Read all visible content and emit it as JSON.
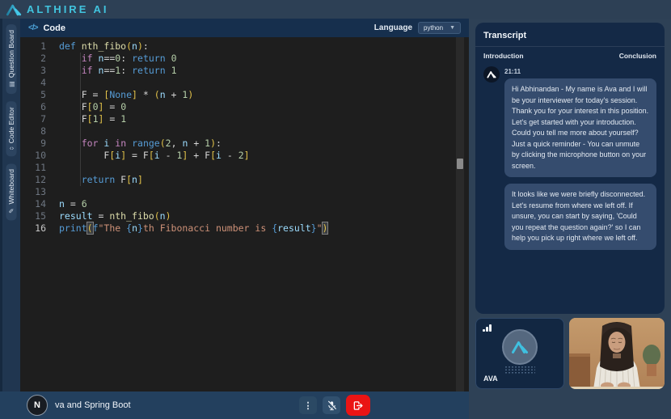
{
  "colors": {
    "accent_cyan": "#41c4de",
    "leave_red": "#ea1414",
    "editor_bg": "#1e1e1e",
    "panel_navy": "#2e4156",
    "card_navy": "#142946",
    "bubble": "#354c6e"
  },
  "header": {
    "brand": "ALTHIRE AI"
  },
  "sidebar": {
    "tabs": [
      {
        "label": "Question Board",
        "icon": "board-icon",
        "glyph": "▤"
      },
      {
        "label": "Code Editor",
        "icon": "code-editor-icon",
        "glyph": "‹›"
      },
      {
        "label": "Whiteboard",
        "icon": "pen-icon",
        "glyph": "✎"
      }
    ]
  },
  "editor": {
    "panel_title": "Code",
    "panel_icon_glyph": "</>",
    "language_label": "Language",
    "language_value": "python",
    "lines": [
      [
        {
          "t": "def ",
          "c": "kw"
        },
        {
          "t": "nth_fibo",
          "c": "fn"
        },
        {
          "t": "(",
          "c": "br"
        },
        {
          "t": "n",
          "c": "var"
        },
        {
          "t": ")",
          "c": "br"
        },
        {
          "t": ":",
          "c": "pl"
        }
      ],
      [
        {
          "t": "    ",
          "c": "pl"
        },
        {
          "t": "if",
          "c": "ctl"
        },
        {
          "t": " ",
          "c": "pl"
        },
        {
          "t": "n",
          "c": "var"
        },
        {
          "t": "==",
          "c": "pl"
        },
        {
          "t": "0",
          "c": "num"
        },
        {
          "t": ": ",
          "c": "pl"
        },
        {
          "t": "return",
          "c": "kw"
        },
        {
          "t": " ",
          "c": "pl"
        },
        {
          "t": "0",
          "c": "num"
        }
      ],
      [
        {
          "t": "    ",
          "c": "pl"
        },
        {
          "t": "if",
          "c": "ctl"
        },
        {
          "t": " ",
          "c": "pl"
        },
        {
          "t": "n",
          "c": "var"
        },
        {
          "t": "==",
          "c": "pl"
        },
        {
          "t": "1",
          "c": "num"
        },
        {
          "t": ": ",
          "c": "pl"
        },
        {
          "t": "return",
          "c": "kw"
        },
        {
          "t": " ",
          "c": "pl"
        },
        {
          "t": "1",
          "c": "num"
        }
      ],
      [],
      [
        {
          "t": "    F = ",
          "c": "pl"
        },
        {
          "t": "[",
          "c": "br"
        },
        {
          "t": "None",
          "c": "kw"
        },
        {
          "t": "]",
          "c": "br"
        },
        {
          "t": " * ",
          "c": "pl"
        },
        {
          "t": "(",
          "c": "br"
        },
        {
          "t": "n",
          "c": "var"
        },
        {
          "t": " + ",
          "c": "pl"
        },
        {
          "t": "1",
          "c": "num"
        },
        {
          "t": ")",
          "c": "br"
        }
      ],
      [
        {
          "t": "    F",
          "c": "pl"
        },
        {
          "t": "[",
          "c": "br"
        },
        {
          "t": "0",
          "c": "num"
        },
        {
          "t": "]",
          "c": "br"
        },
        {
          "t": " = ",
          "c": "pl"
        },
        {
          "t": "0",
          "c": "num"
        }
      ],
      [
        {
          "t": "    F",
          "c": "pl"
        },
        {
          "t": "[",
          "c": "br"
        },
        {
          "t": "1",
          "c": "num"
        },
        {
          "t": "]",
          "c": "br"
        },
        {
          "t": " = ",
          "c": "pl"
        },
        {
          "t": "1",
          "c": "num"
        }
      ],
      [],
      [
        {
          "t": "    ",
          "c": "pl"
        },
        {
          "t": "for",
          "c": "ctl"
        },
        {
          "t": " ",
          "c": "pl"
        },
        {
          "t": "i",
          "c": "var"
        },
        {
          "t": " ",
          "c": "pl"
        },
        {
          "t": "in",
          "c": "ctl"
        },
        {
          "t": " ",
          "c": "pl"
        },
        {
          "t": "range",
          "c": "kw"
        },
        {
          "t": "(",
          "c": "br"
        },
        {
          "t": "2",
          "c": "num"
        },
        {
          "t": ", ",
          "c": "pl"
        },
        {
          "t": "n",
          "c": "var"
        },
        {
          "t": " + ",
          "c": "pl"
        },
        {
          "t": "1",
          "c": "num"
        },
        {
          "t": ")",
          "c": "br"
        },
        {
          "t": ":",
          "c": "pl"
        }
      ],
      [
        {
          "t": "        F",
          "c": "pl"
        },
        {
          "t": "[",
          "c": "br"
        },
        {
          "t": "i",
          "c": "var"
        },
        {
          "t": "]",
          "c": "br"
        },
        {
          "t": " = F",
          "c": "pl"
        },
        {
          "t": "[",
          "c": "br"
        },
        {
          "t": "i",
          "c": "var"
        },
        {
          "t": " - ",
          "c": "pl"
        },
        {
          "t": "1",
          "c": "num"
        },
        {
          "t": "]",
          "c": "br"
        },
        {
          "t": " + F",
          "c": "pl"
        },
        {
          "t": "[",
          "c": "br"
        },
        {
          "t": "i",
          "c": "var"
        },
        {
          "t": " - ",
          "c": "pl"
        },
        {
          "t": "2",
          "c": "num"
        },
        {
          "t": "]",
          "c": "br"
        }
      ],
      [],
      [
        {
          "t": "    ",
          "c": "pl"
        },
        {
          "t": "return",
          "c": "kw"
        },
        {
          "t": " F",
          "c": "pl"
        },
        {
          "t": "[",
          "c": "br"
        },
        {
          "t": "n",
          "c": "var"
        },
        {
          "t": "]",
          "c": "br"
        }
      ],
      [],
      [
        {
          "t": "n",
          "c": "var"
        },
        {
          "t": " = ",
          "c": "pl"
        },
        {
          "t": "6",
          "c": "num"
        }
      ],
      [
        {
          "t": "result",
          "c": "var"
        },
        {
          "t": " = ",
          "c": "pl"
        },
        {
          "t": "nth_fibo",
          "c": "fn"
        },
        {
          "t": "(",
          "c": "br"
        },
        {
          "t": "n",
          "c": "var"
        },
        {
          "t": ")",
          "c": "br"
        }
      ],
      [
        {
          "t": "print",
          "c": "kw"
        },
        {
          "t": "(",
          "c": "hl"
        },
        {
          "t": "f",
          "c": "kw"
        },
        {
          "t": "\"The ",
          "c": "str"
        },
        {
          "t": "{",
          "c": "kw"
        },
        {
          "t": "n",
          "c": "var"
        },
        {
          "t": "}",
          "c": "kw"
        },
        {
          "t": "th Fibonacci number is ",
          "c": "str"
        },
        {
          "t": "{",
          "c": "kw"
        },
        {
          "t": "result",
          "c": "var"
        },
        {
          "t": "}",
          "c": "kw"
        },
        {
          "t": "\"",
          "c": "str"
        },
        {
          "t": ")",
          "c": "hl"
        }
      ]
    ]
  },
  "transcript": {
    "title": "Transcript",
    "stages": [
      "Introduction",
      "Conclusion"
    ],
    "messages": [
      {
        "time": "21:11",
        "text": "Hi Abhinandan - My name is Ava and I will be your interviewer for today's session. Thank you for your interest in this position. Let's get started with your introduction. Could you tell me more about yourself? Just a quick reminder - You can unmute by clicking the microphone button on your screen."
      },
      {
        "text": "It looks like we were briefly disconnected. Let's resume from where we left off. If unsure, you can start by saying, 'Could you repeat the question again?' so I can help you pick up right where we left off."
      }
    ]
  },
  "call": {
    "ava_label": "AVA"
  },
  "bottombar": {
    "session_title": "va and Spring Boot",
    "avatar_letter": "N",
    "kebab_glyph": "⋮"
  }
}
